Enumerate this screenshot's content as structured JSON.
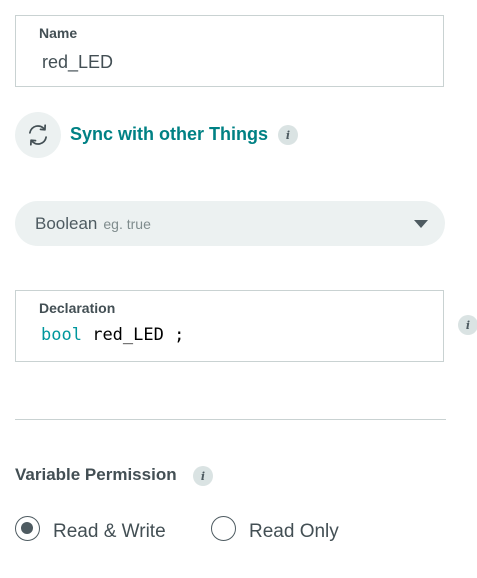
{
  "name": {
    "label": "Name",
    "value": "red_LED"
  },
  "sync": {
    "label": "Sync with other Things",
    "info_icon": "info-icon"
  },
  "type_select": {
    "value": "Boolean",
    "hint": "eg. true"
  },
  "declaration": {
    "label": "Declaration",
    "keyword": "bool",
    "identifier": "red_LED",
    "terminator": ";"
  },
  "permission": {
    "title": "Variable Permission",
    "options": [
      {
        "label": "Read & Write",
        "selected": true
      },
      {
        "label": "Read Only",
        "selected": false
      }
    ]
  },
  "colors": {
    "accent": "#008184",
    "keyword": "#00979d",
    "text": "#434f54",
    "pill_bg": "#ecf1f1"
  }
}
